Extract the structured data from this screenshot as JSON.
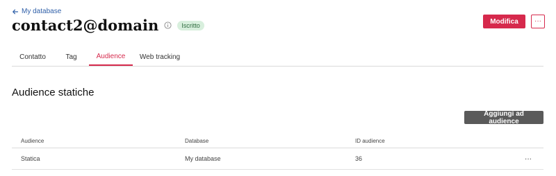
{
  "header": {
    "back_label": "My database",
    "title": "contact2@domain",
    "status_badge": "Iscritto",
    "edit_button": "Modifica",
    "more_button": "···"
  },
  "tabs": [
    {
      "label": "Contatto",
      "active": false
    },
    {
      "label": "Tag",
      "active": false
    },
    {
      "label": "Audience",
      "active": true
    },
    {
      "label": "Web tracking",
      "active": false
    }
  ],
  "section": {
    "title": "Audience statiche",
    "add_button": "Aggiungi ad audience"
  },
  "table": {
    "columns": [
      "Audience",
      "Database",
      "ID audience"
    ],
    "rows": [
      {
        "audience": "Statica",
        "database": "My database",
        "id": "36",
        "actions": "···"
      }
    ]
  },
  "colors": {
    "accent": "#d6294c",
    "link": "#2f5fa8",
    "badge_bg": "#d8efdd",
    "badge_text": "#2e6b3e",
    "secondary_button": "#5a5a5a"
  }
}
